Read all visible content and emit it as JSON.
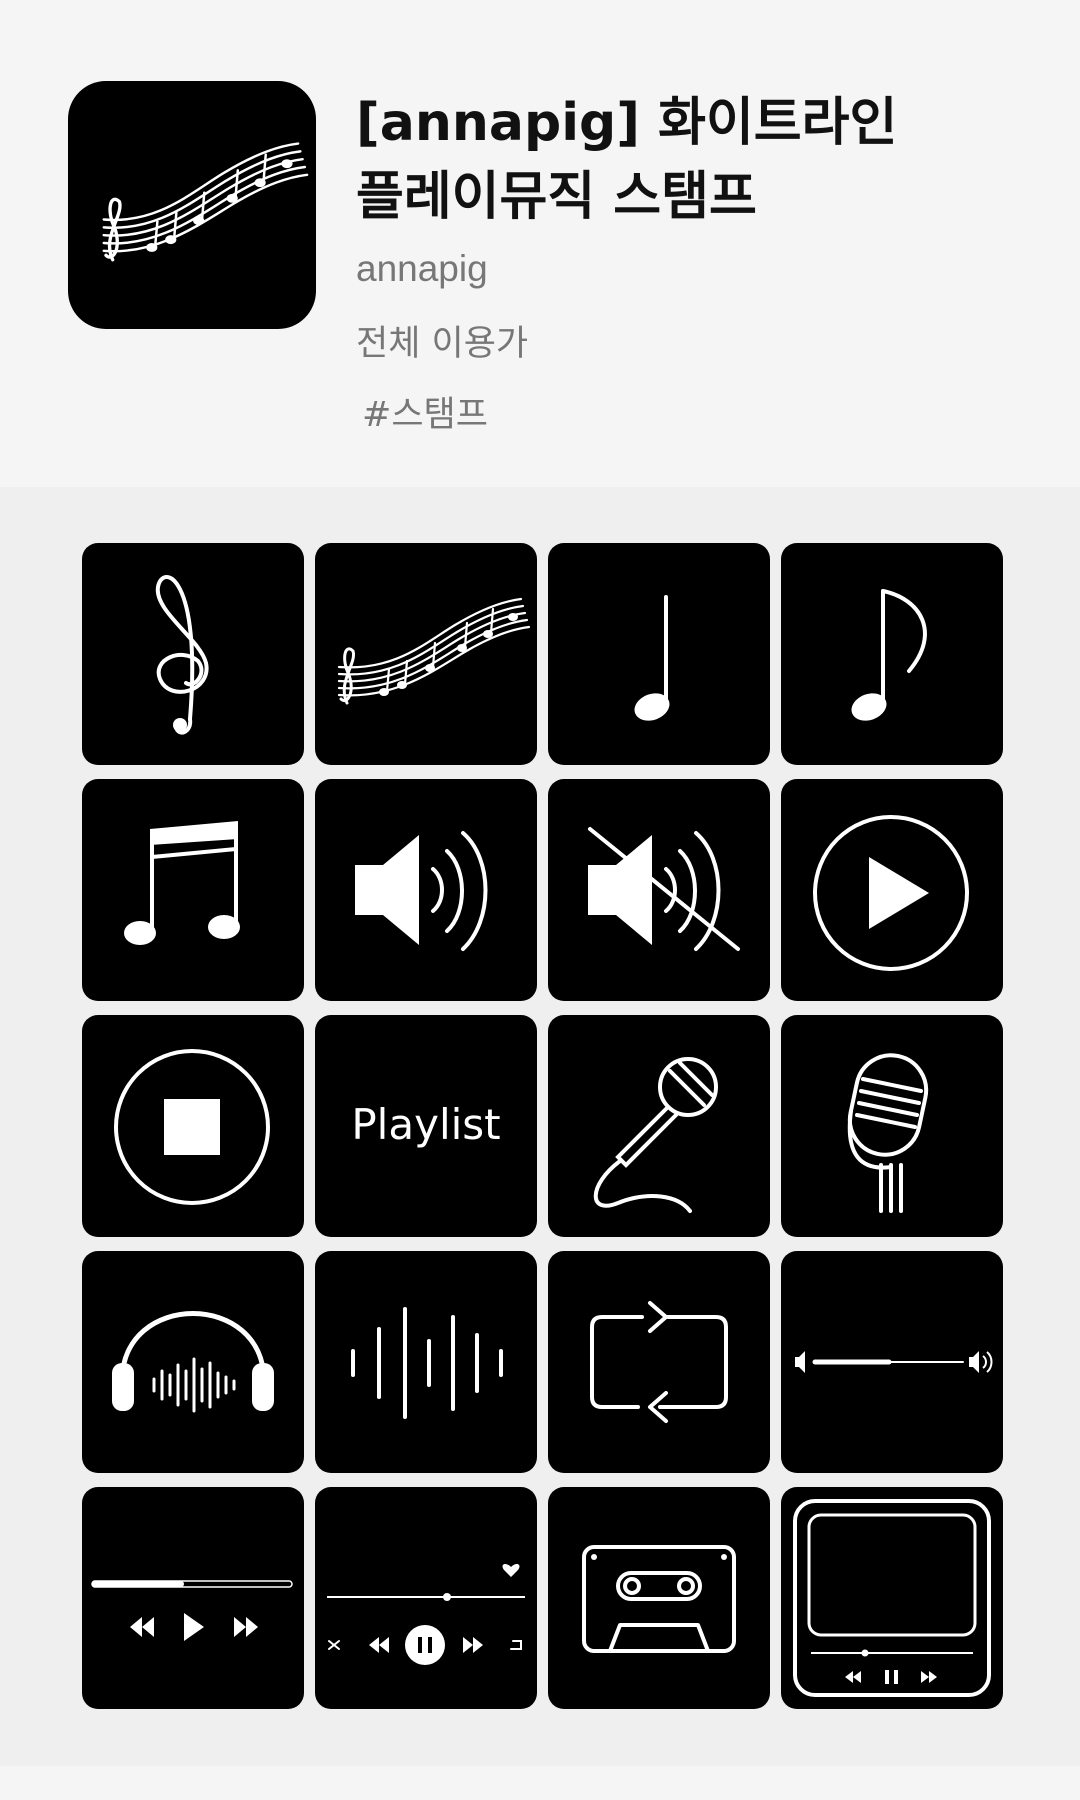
{
  "sticker": {
    "title_line1": "[annapig] 화이트라인",
    "title_line2": "플레이뮤직 스탬프",
    "author": "annapig",
    "rating": "전체 이용가",
    "tag": "#스탬프"
  },
  "stamps": [
    {
      "icon": "treble-clef-icon"
    },
    {
      "icon": "music-staff-icon"
    },
    {
      "icon": "quarter-note-icon"
    },
    {
      "icon": "eighth-note-icon"
    },
    {
      "icon": "beamed-notes-icon"
    },
    {
      "icon": "speaker-icon"
    },
    {
      "icon": "speaker-muted-icon"
    },
    {
      "icon": "play-circle-icon"
    },
    {
      "icon": "stop-circle-icon"
    },
    {
      "icon": "playlist-text-icon",
      "text": "Playlist"
    },
    {
      "icon": "handheld-microphone-icon"
    },
    {
      "icon": "studio-microphone-icon"
    },
    {
      "icon": "headphones-icon"
    },
    {
      "icon": "sound-wave-icon"
    },
    {
      "icon": "repeat-icon"
    },
    {
      "icon": "volume-slider-icon"
    },
    {
      "icon": "player-controls-icon"
    },
    {
      "icon": "player-controls-shuffle-icon"
    },
    {
      "icon": "cassette-tape-icon"
    },
    {
      "icon": "music-player-screen-icon"
    }
  ],
  "colors": {
    "tile": "#000000",
    "line": "#ffffff",
    "page": "#f5f5f5",
    "grid_bg": "#efefef"
  }
}
